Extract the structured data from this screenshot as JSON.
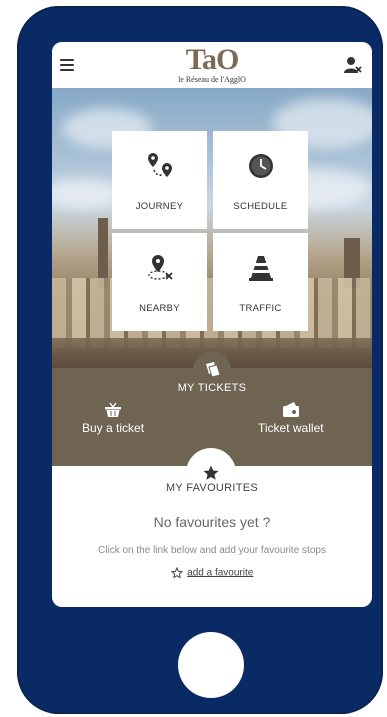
{
  "header": {
    "logo_text": "TaO",
    "logo_subtitle": "le Réseau de l'AgglO",
    "menu_icon": "hamburger-menu-icon",
    "user_icon": "user-logout-icon"
  },
  "tiles": [
    {
      "label": "JOURNEY",
      "icon": "route-pins-icon"
    },
    {
      "label": "SCHEDULE",
      "icon": "clock-icon"
    },
    {
      "label": "NEARBY",
      "icon": "location-nearby-icon"
    },
    {
      "label": "TRAFFIC",
      "icon": "traffic-cone-icon"
    }
  ],
  "tickets": {
    "title": "MY TICKETS",
    "icon": "tickets-icon",
    "buy_label": "Buy a ticket",
    "buy_icon": "basket-icon",
    "wallet_label": "Ticket wallet",
    "wallet_icon": "wallet-icon"
  },
  "favourites": {
    "title": "MY FAVOURITES",
    "icon": "star-icon",
    "empty_text": "No favourites yet ?",
    "help_text": "Click on the link below and add your favourite stops",
    "add_link": "add a favourite",
    "add_icon": "star-outline-icon"
  },
  "colors": {
    "phone_frame": "#0a2a66",
    "brand_brown": "#6f6351",
    "logo_brown": "#7b6a55"
  }
}
